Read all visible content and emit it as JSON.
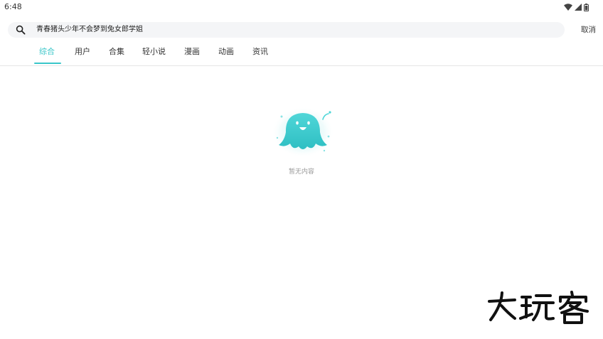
{
  "status_bar": {
    "time": "6:48",
    "icons": [
      "wifi-icon",
      "signal-icon",
      "battery-icon"
    ]
  },
  "search": {
    "query": "青春猪头少年不会梦到兔女郎学姐",
    "cancel_label": "取消"
  },
  "tabs": [
    {
      "label": "综合",
      "active": true
    },
    {
      "label": "用户",
      "active": false
    },
    {
      "label": "合集",
      "active": false
    },
    {
      "label": "轻小说",
      "active": false
    },
    {
      "label": "漫画",
      "active": false
    },
    {
      "label": "动画",
      "active": false
    },
    {
      "label": "资讯",
      "active": false
    }
  ],
  "empty_state": {
    "message": "暂无内容",
    "illustration": "cyan-blob-mascot"
  },
  "watermark": {
    "text": "大玩客"
  },
  "colors": {
    "accent": "#3ac6c9",
    "search_bg": "#f4f5f7",
    "muted_text": "#9a9a9a"
  }
}
